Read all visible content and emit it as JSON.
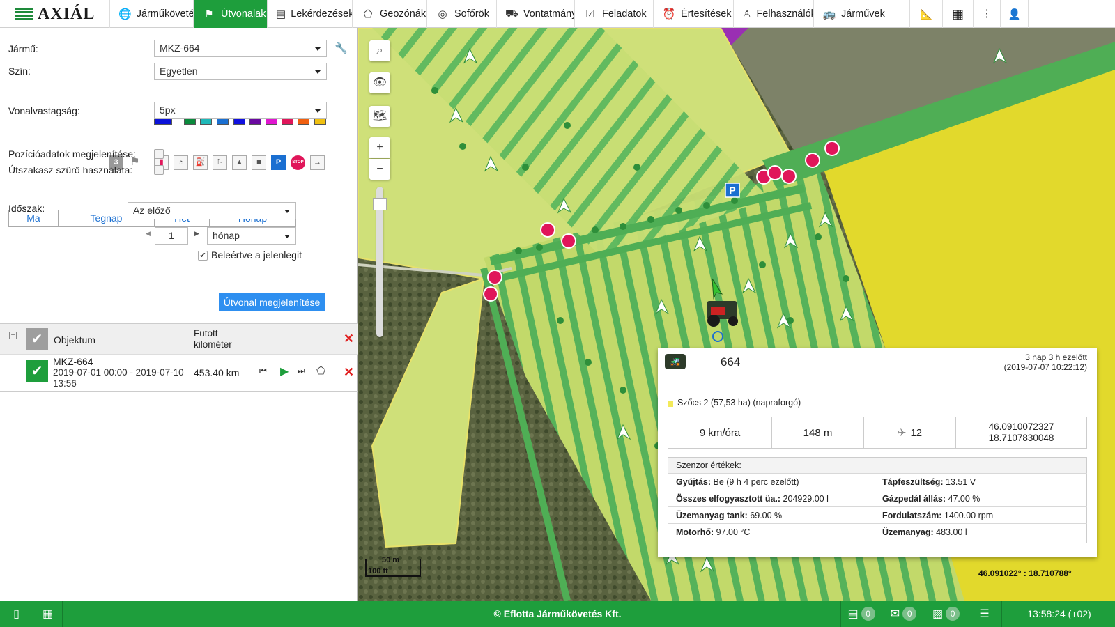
{
  "app": {
    "logo": "AXIÁL"
  },
  "nav": [
    {
      "label": "Járműkövetés",
      "icon": "globe-icon",
      "active": false
    },
    {
      "label": "Útvonalak",
      "icon": "route-flag-icon",
      "active": true
    },
    {
      "label": "Lekérdezések",
      "icon": "report-icon",
      "active": false
    },
    {
      "label": "Geozónák",
      "icon": "geozone-icon",
      "active": false
    },
    {
      "label": "Sofőrök",
      "icon": "steering-wheel-icon",
      "active": false
    },
    {
      "label": "Vontatmányok",
      "icon": "trailer-icon",
      "active": false
    },
    {
      "label": "Feladatok",
      "icon": "task-icon",
      "active": false
    },
    {
      "label": "Értesítések",
      "icon": "alarm-icon",
      "active": false
    },
    {
      "label": "Felhasználók",
      "icon": "user-icon",
      "active": false
    },
    {
      "label": "Járművek",
      "icon": "bus-icon",
      "active": false
    }
  ],
  "left": {
    "vehicle_label": "Jármű:",
    "vehicle_value": "MKZ-664",
    "color_label": "Szín:",
    "color_value": "Egyetlen",
    "swatches": [
      "#0b12d9",
      "#0a8a3c",
      "#1fb8b8",
      "#1a6fd1",
      "#1010e0",
      "#6a0aa0",
      "#e016d0",
      "#e0165a",
      "#f06010",
      "#f0c010"
    ],
    "line_label": "Vonalvastagság:",
    "line_value": "5px",
    "toolbar_number": "3",
    "pos_label": "Pozícióadatok megjelenítése:",
    "filter_label": "Útszakasz szűrő használata:",
    "tabs": [
      "Ma",
      "Tegnap",
      "Hét",
      "Hónap"
    ],
    "period_label": "Időszak:",
    "period_value": "Az előző",
    "count_value": "1",
    "unit_value": "hónap",
    "include_label": "Beleértve a jelenlegit",
    "show_button": "Útvonal megjelenítése",
    "table": {
      "col_object": "Objektum",
      "col_km": "Futott kilométer",
      "row": {
        "name": "MKZ-664",
        "range": "2019-07-01  00:00 - 2019-07-10  13:56",
        "km": "453.40 km"
      }
    }
  },
  "map": {
    "scale_m": "50 m",
    "scale_ft": "100 ft",
    "coords": "46.091022° : 18.710788°",
    "parking": "P",
    "stop": "STOP"
  },
  "popup": {
    "vehicle": "664",
    "ago": "3 nap 3 h ezelőtt",
    "ts": "(2019-07-07 10:22:12)",
    "field": "Szőcs 2 (57,53 ha) (napraforgó)",
    "speed": "9 km/óra",
    "altitude": "148 m",
    "satellites": "12",
    "lat": "46.0910072327",
    "lon": "18.7107830048",
    "sensor_title": "Szenzor értékek:",
    "sensors_left": [
      {
        "k": "Gyújtás:",
        "v": "Be (9 h 4 perc ezelőtt)"
      },
      {
        "k": "Összes elfogyasztott üa.:",
        "v": "204929.00 l"
      },
      {
        "k": "Üzemanyag tank:",
        "v": "69.00 %"
      },
      {
        "k": "Motorhő:",
        "v": "97.00 °C"
      }
    ],
    "sensors_right": [
      {
        "k": "Tápfeszültség:",
        "v": "13.51 V"
      },
      {
        "k": "Gázpedál állás:",
        "v": "47.00 %"
      },
      {
        "k": "Fordulatszám:",
        "v": "1400.00 rpm"
      },
      {
        "k": "Üzemanyag:",
        "v": "483.00 l"
      }
    ]
  },
  "footer": {
    "copyright": "© Eflotta Járműkövetés Kft.",
    "badge1": "0",
    "badge2": "0",
    "badge3": "0",
    "time": "13:58:24 (+02)"
  }
}
